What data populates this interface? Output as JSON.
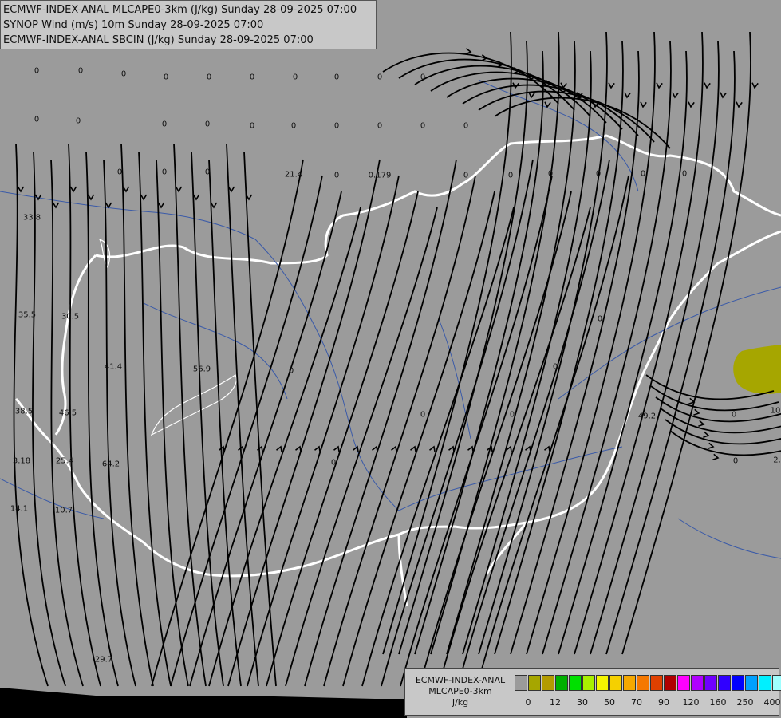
{
  "header": {
    "lines": [
      "ECMWF-INDEX-ANAL MLCAPE0-3km (J/kg) Sunday 28-09-2025 07:00",
      "SYNOP Wind (m/s) 10m Sunday 28-09-2025 07:00",
      "ECMWF-INDEX-ANAL SBCIN (J/kg) Sunday 28-09-2025 07:00"
    ]
  },
  "legend": {
    "title_lines": [
      "ECMWF-INDEX-ANAL",
      "MLCAPE0-3km",
      "J/kg"
    ],
    "colors": [
      "#9b9b9b",
      "#a6a600",
      "#b39b00",
      "#00b000",
      "#00e000",
      "#a8f000",
      "#f5f500",
      "#f5d000",
      "#f5a800",
      "#f57800",
      "#e04000",
      "#b00000",
      "#ff00ff",
      "#b000ff",
      "#7000ff",
      "#3000ff",
      "#0000ff",
      "#00a0ff",
      "#00f0ff",
      "#a0ffff",
      "#ffffff"
    ],
    "ticks": [
      "0",
      "12",
      "30",
      "50",
      "70",
      "90",
      "120",
      "160",
      "250",
      "400"
    ]
  },
  "map_values": [
    {
      "t": "0"
    },
    {
      "t": "0"
    },
    {
      "t": "0"
    },
    {
      "t": "0"
    },
    {
      "t": "0"
    },
    {
      "t": "0"
    },
    {
      "t": "0"
    },
    {
      "t": "0"
    },
    {
      "t": "0"
    },
    {
      "t": "0"
    },
    {
      "t": "0"
    },
    {
      "t": "0"
    },
    {
      "t": "0"
    },
    {
      "t": "0"
    },
    {
      "t": "0"
    },
    {
      "t": "0"
    },
    {
      "t": "0"
    },
    {
      "t": "0"
    },
    {
      "t": "0"
    },
    {
      "t": "0"
    },
    {
      "t": "0"
    },
    {
      "t": "0"
    },
    {
      "t": "0"
    },
    {
      "t": "0"
    },
    {
      "t": "0"
    },
    {
      "t": "0"
    },
    {
      "t": "0"
    },
    {
      "t": "0"
    },
    {
      "t": "0"
    },
    {
      "t": "0"
    },
    {
      "t": "21.4"
    },
    {
      "t": "0.179"
    },
    {
      "t": "33.8"
    },
    {
      "t": "35.5"
    },
    {
      "t": "30.5"
    },
    {
      "t": "41.4"
    },
    {
      "t": "56.9"
    },
    {
      "t": "38.5"
    },
    {
      "t": "46.5"
    },
    {
      "t": "3.18"
    },
    {
      "t": "25.4"
    },
    {
      "t": "64.2"
    },
    {
      "t": "14.1"
    },
    {
      "t": "10.7"
    },
    {
      "t": "29.7"
    },
    {
      "t": "49.2"
    },
    {
      "t": "10"
    },
    {
      "t": "2."
    },
    {
      "t": "0"
    },
    {
      "t": "0"
    },
    {
      "t": "0"
    },
    {
      "t": "0"
    },
    {
      "t": "0"
    },
    {
      "t": "0"
    },
    {
      "t": "0"
    },
    {
      "t": "0"
    }
  ]
}
